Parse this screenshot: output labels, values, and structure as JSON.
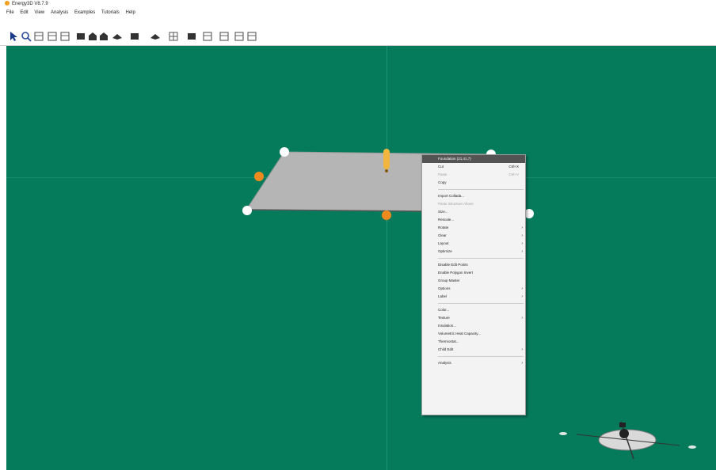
{
  "window": {
    "title": "Energy3D V8.7.9"
  },
  "menubar": {
    "items": [
      "File",
      "Edit",
      "View",
      "Analysis",
      "Examples",
      "Tutorials",
      "Help"
    ]
  },
  "toolbar": {
    "tools": [
      {
        "name": "select-tool-icon",
        "glyph": "cursor"
      },
      {
        "name": "zoom-tool-icon",
        "glyph": "magnifier"
      },
      {
        "name": "rotate-view-icon",
        "glyph": "box"
      },
      {
        "name": "pan-view-icon",
        "glyph": "box"
      },
      {
        "name": "reset-view-icon",
        "glyph": "box"
      },
      {
        "name": "foundation-tool-icon",
        "glyph": "square"
      },
      {
        "name": "wall-tool-icon",
        "glyph": "house"
      },
      {
        "name": "building-tool-icon",
        "glyph": "house"
      },
      {
        "name": "roof-tool-icon",
        "glyph": "roof"
      },
      {
        "name": "solar-panel-tool-icon",
        "glyph": "square"
      },
      {
        "name": "tree-tool-icon",
        "glyph": "roof"
      },
      {
        "name": "window-tool-icon",
        "glyph": "grid"
      },
      {
        "name": "human-tool-icon",
        "glyph": "square"
      },
      {
        "name": "sun-tool-icon",
        "glyph": "box"
      },
      {
        "name": "annotation-tool-icon",
        "glyph": "box"
      },
      {
        "name": "heliodon-tool-icon",
        "glyph": "box"
      },
      {
        "name": "shadow-tool-icon",
        "glyph": "box"
      }
    ]
  },
  "viewport": {
    "background_color": "#067b5c"
  },
  "context_menu": {
    "items": [
      {
        "type": "item",
        "label": "Foundation (21,41,7)",
        "state": "highlight"
      },
      {
        "type": "item",
        "label": "Cut",
        "shortcut": "Ctrl+X"
      },
      {
        "type": "item",
        "label": "Paste",
        "shortcut": "Ctrl+V",
        "state": "disabled"
      },
      {
        "type": "item",
        "label": "Copy"
      },
      {
        "type": "separator"
      },
      {
        "type": "item",
        "label": "Import Collada..."
      },
      {
        "type": "item",
        "label": "Paste Structure Above",
        "state": "disabled"
      },
      {
        "type": "item",
        "label": "Size..."
      },
      {
        "type": "item",
        "label": "Rescale..."
      },
      {
        "type": "item",
        "label": "Rotate",
        "submenu": true
      },
      {
        "type": "item",
        "label": "Clear",
        "submenu": true
      },
      {
        "type": "item",
        "label": "Layout",
        "submenu": true
      },
      {
        "type": "item",
        "label": "Optimize",
        "submenu": true
      },
      {
        "type": "separator"
      },
      {
        "type": "item",
        "label": "Disable Edit Points"
      },
      {
        "type": "item",
        "label": "Enable Polygon Invert"
      },
      {
        "type": "item",
        "label": "Group Master"
      },
      {
        "type": "item",
        "label": "Options",
        "submenu": true
      },
      {
        "type": "item",
        "label": "Label",
        "submenu": true
      },
      {
        "type": "separator"
      },
      {
        "type": "item",
        "label": "Color..."
      },
      {
        "type": "item",
        "label": "Texture",
        "submenu": true
      },
      {
        "type": "item",
        "label": "Insulation..."
      },
      {
        "type": "item",
        "label": "Volumetric Heat Capacity..."
      },
      {
        "type": "item",
        "label": "Thermostat..."
      },
      {
        "type": "item",
        "label": "Child Edit",
        "submenu": true
      },
      {
        "type": "separator"
      },
      {
        "type": "item",
        "label": "Analysis",
        "submenu": true
      }
    ]
  }
}
